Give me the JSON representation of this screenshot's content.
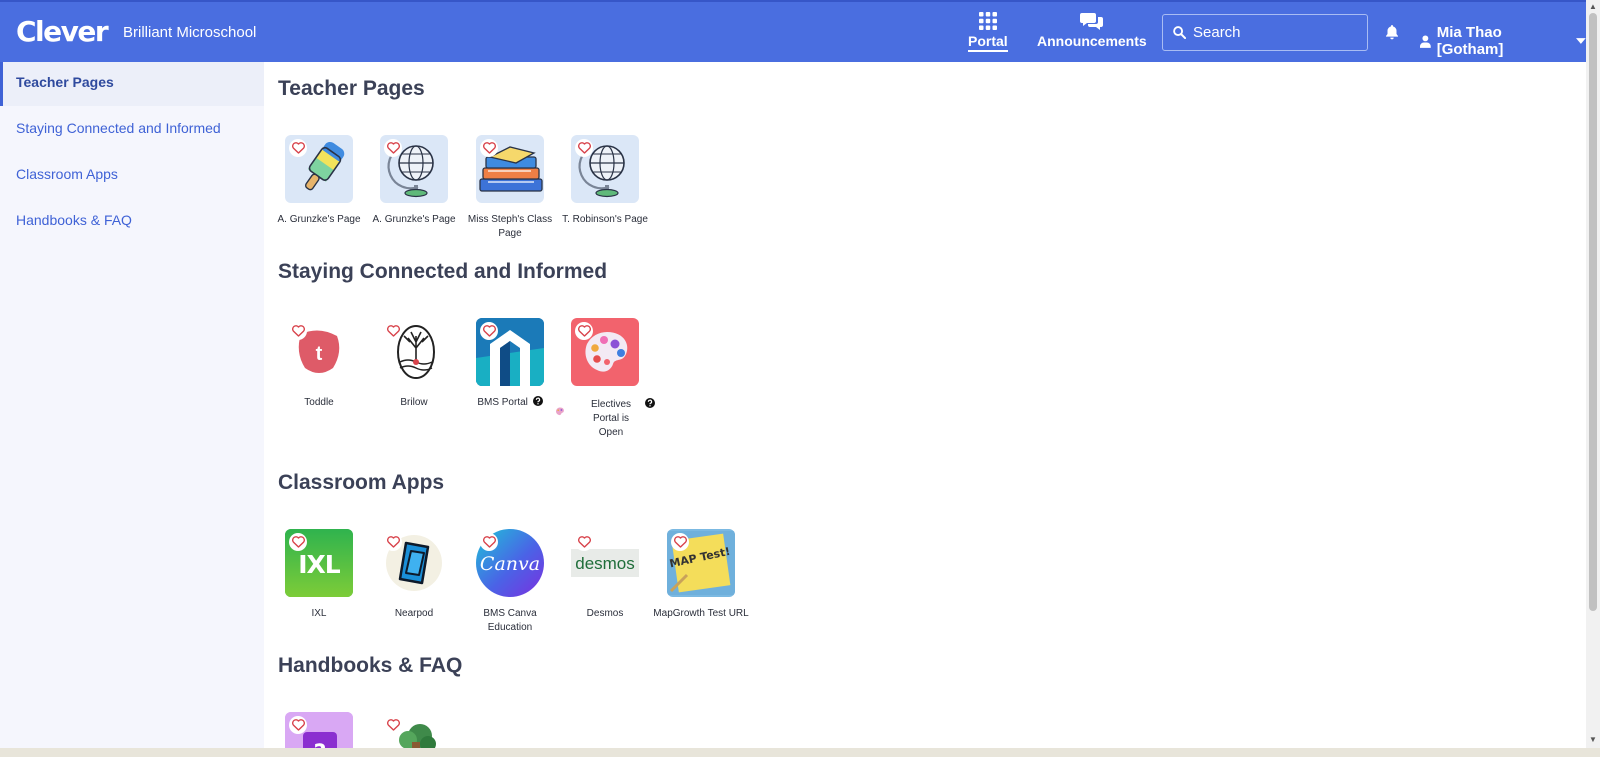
{
  "header": {
    "logo": "Clever",
    "district": "Brilliant Microschool",
    "nav": [
      {
        "label": "Portal",
        "icon": "grid-icon",
        "active": true
      },
      {
        "label": "Announcements",
        "icon": "chat-bubbles-icon",
        "active": false
      }
    ],
    "search": {
      "placeholder": "Search",
      "value": ""
    },
    "user": {
      "name": "Mia Thao [Gotham]"
    }
  },
  "sidebar": {
    "items": [
      {
        "label": "Teacher Pages",
        "active": true
      },
      {
        "label": "Staying Connected and Informed",
        "active": false
      },
      {
        "label": "Classroom Apps",
        "active": false
      },
      {
        "label": "Handbooks & FAQ",
        "active": false
      }
    ]
  },
  "sections": [
    {
      "title": "Teacher Pages",
      "apps": [
        {
          "label": "A. Grunzke's Page",
          "icon": "popsicle-icon"
        },
        {
          "label": "A. Grunzke's Page",
          "icon": "globe-icon"
        },
        {
          "label": "Miss Steph's Class Page",
          "icon": "books-icon"
        },
        {
          "label": "T. Robinson's Page",
          "icon": "globe-icon"
        }
      ]
    },
    {
      "title": "Staying Connected and Informed",
      "apps": [
        {
          "label": "Toddle",
          "icon": "toddle-logo-icon"
        },
        {
          "label": "Brilow",
          "icon": "tree-logo-icon"
        },
        {
          "label": "BMS Portal",
          "icon": "arch-logo-icon",
          "help": true
        },
        {
          "label": "Electives Portal is Open",
          "icon": "paint-palette-icon",
          "help": true
        }
      ]
    },
    {
      "title": "Classroom Apps",
      "apps": [
        {
          "label": "IXL",
          "icon": "ixl-logo-icon"
        },
        {
          "label": "Nearpod",
          "icon": "nearpod-logo-icon"
        },
        {
          "label": "BMS Canva Education",
          "icon": "canva-logo-icon"
        },
        {
          "label": "Desmos",
          "icon": "desmos-logo-icon"
        },
        {
          "label": "MapGrowth Test URL",
          "icon": "map-test-note-icon"
        }
      ]
    },
    {
      "title": "Handbooks & FAQ",
      "apps": [
        {
          "label": "",
          "icon": "question-box-icon"
        },
        {
          "label": "",
          "icon": "tree-illustration-icon"
        }
      ]
    }
  ],
  "logo_text": {
    "ixl": "IXL",
    "canva": "Canva",
    "desmos": "desmos",
    "maptest": "MAP Test!",
    "toddle": "t"
  },
  "colors": {
    "header": "#4a6ee0",
    "accent": "#3f62d6",
    "sidebar_bg": "#f5f6fd",
    "heart": "#d8434b"
  }
}
